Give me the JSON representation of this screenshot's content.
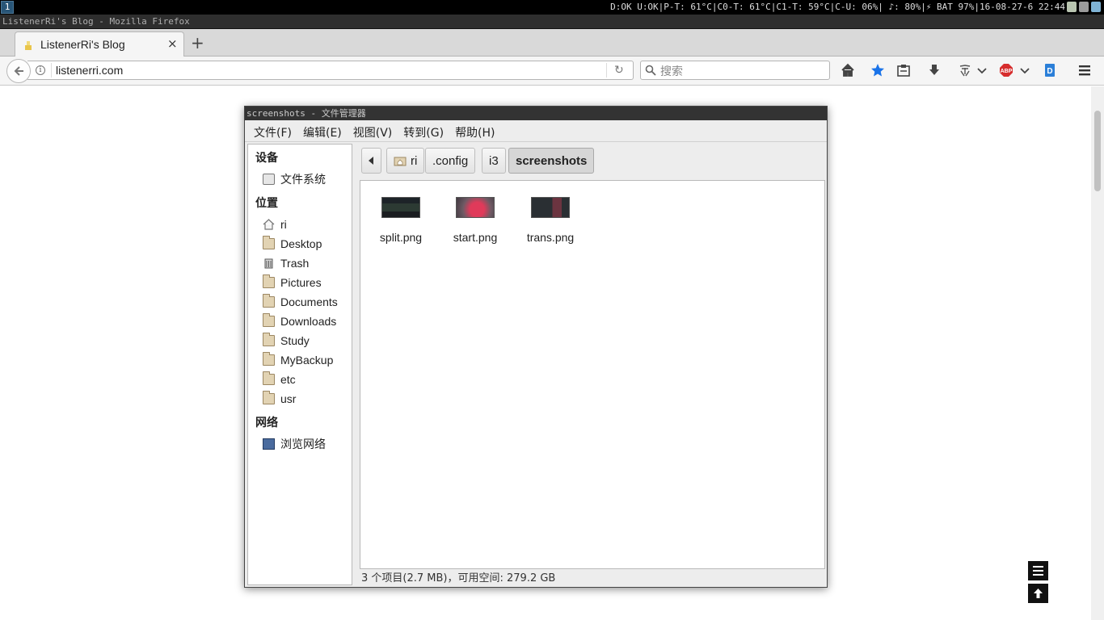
{
  "i3bar": {
    "workspace": "1",
    "status": "D:OK U:OK|P-T: 61°C|C0-T: 61°C|C1-T: 59°C|C-U: 06%| ♪: 80%|⚡ BAT 97%|16-08-27-6 22:44"
  },
  "browser": {
    "window_title": "ListenerRi's Blog - Mozilla Firefox",
    "tab": {
      "title": "ListenerRi's Blog",
      "close": "×"
    },
    "new_tab": "+",
    "url": "listenerri.com",
    "search_placeholder": "搜索"
  },
  "filemanager": {
    "title": "screenshots - 文件管理器",
    "menu": [
      "文件(F)",
      "编辑(E)",
      "视图(V)",
      "转到(G)",
      "帮助(H)"
    ],
    "sidebar": {
      "devices_heading": "设备",
      "devices": [
        {
          "label": "文件系统",
          "icon": "disk-icon"
        }
      ],
      "places_heading": "位置",
      "places": [
        {
          "label": "ri",
          "icon": "home-icon"
        },
        {
          "label": "Desktop",
          "icon": "folder-icon"
        },
        {
          "label": "Trash",
          "icon": "trash-icon"
        },
        {
          "label": "Pictures",
          "icon": "folder-icon"
        },
        {
          "label": "Documents",
          "icon": "folder-icon"
        },
        {
          "label": "Downloads",
          "icon": "folder-icon"
        },
        {
          "label": "Study",
          "icon": "folder-icon"
        },
        {
          "label": "MyBackup",
          "icon": "folder-icon"
        },
        {
          "label": "etc",
          "icon": "folder-icon"
        },
        {
          "label": "usr",
          "icon": "folder-icon"
        }
      ],
      "network_heading": "网络",
      "network": [
        {
          "label": "浏览网络",
          "icon": "network-icon"
        }
      ]
    },
    "path": [
      "ri",
      ".config",
      "i3",
      "screenshots"
    ],
    "files": [
      {
        "name": "split.png"
      },
      {
        "name": "start.png"
      },
      {
        "name": "trans.png"
      }
    ],
    "status": "3 个项目(2.7 MB)，可用空间: 279.2 GB"
  },
  "colors": {
    "wm_title_bg": "#333333",
    "i3bar_bg": "#000000",
    "workspace_bg": "#285577",
    "star_blue": "#1a73e8",
    "abp_red": "#d62d2d"
  }
}
